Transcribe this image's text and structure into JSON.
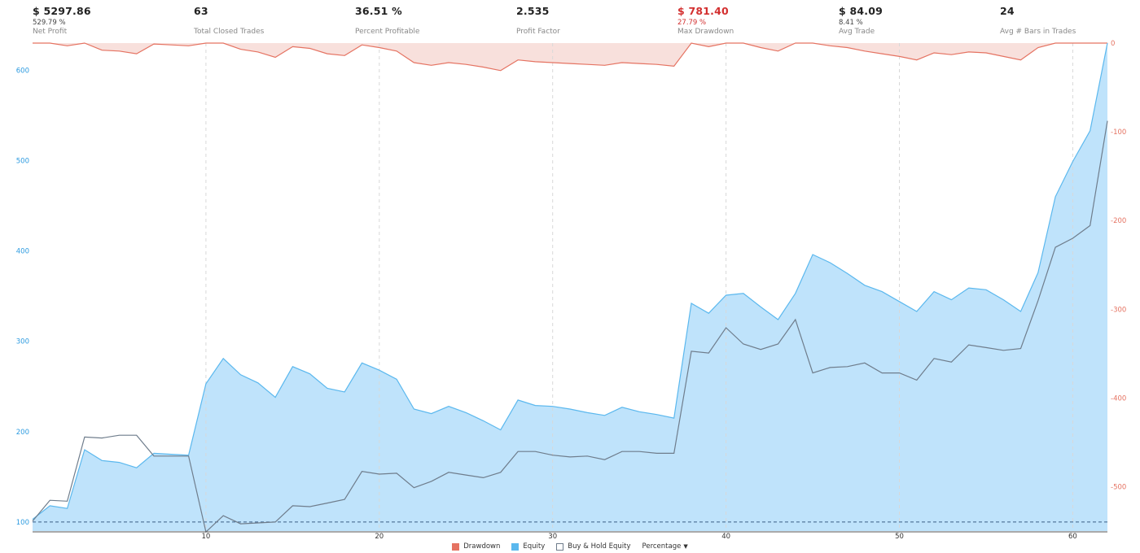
{
  "stats": [
    {
      "value": "$ 5297.86",
      "sub": "529.79 %",
      "label": "Net Profit",
      "red": false
    },
    {
      "value": "63",
      "sub": "",
      "label": "Total Closed Trades",
      "red": false
    },
    {
      "value": "36.51 %",
      "sub": "",
      "label": "Percent Profitable",
      "red": false
    },
    {
      "value": "2.535",
      "sub": "",
      "label": "Profit Factor",
      "red": false
    },
    {
      "value": "$ 781.40",
      "sub": "27.79 %",
      "label": "Max Drawdown",
      "red": true
    },
    {
      "value": "$ 84.09",
      "sub": "8.41 %",
      "label": "Avg Trade",
      "red": false
    },
    {
      "value": "24",
      "sub": "",
      "label": "Avg # Bars in Trades",
      "red": false
    }
  ],
  "legend": {
    "drawdown": "Drawdown",
    "equity": "Equity",
    "buyhold": "Buy & Hold Equity",
    "mode": "Percentage"
  },
  "colors": {
    "equity_fill": "#bfe3fb",
    "equity_line": "#5bb8ee",
    "drawdown_fill": "#f8e0dc",
    "drawdown_line": "#e57362",
    "buyhold_line": "#6f7d8c",
    "left_axis": "#2d9be0",
    "right_axis": "#e57362"
  },
  "chart_data": {
    "type": "area",
    "x": [
      0,
      1,
      2,
      3,
      4,
      5,
      6,
      7,
      8,
      9,
      10,
      11,
      12,
      13,
      14,
      15,
      16,
      17,
      18,
      19,
      20,
      21,
      22,
      23,
      24,
      25,
      26,
      27,
      28,
      29,
      30,
      31,
      32,
      33,
      34,
      35,
      36,
      37,
      38,
      39,
      40,
      41,
      42,
      43,
      44,
      45,
      46,
      47,
      48,
      49,
      50,
      51,
      52,
      53,
      54,
      55,
      56,
      57,
      58,
      59,
      60,
      61,
      62
    ],
    "xticks": [
      10,
      20,
      30,
      40,
      50,
      60
    ],
    "xlim": [
      0,
      62
    ],
    "equity_axis": {
      "ylim": [
        90,
        630
      ],
      "ticks": [
        100,
        200,
        300,
        400,
        500,
        600
      ]
    },
    "drawdown_axis": {
      "ylim": [
        -550,
        0
      ],
      "ticks": [
        0,
        -100,
        -200,
        -300,
        -400,
        -500
      ]
    },
    "baseline": 100,
    "series": [
      {
        "name": "Equity",
        "values": [
          103,
          118,
          115,
          180,
          168,
          166,
          160,
          176,
          175,
          174,
          253,
          281,
          263,
          254,
          238,
          272,
          264,
          248,
          244,
          276,
          268,
          258,
          225,
          220,
          228,
          221,
          212,
          202,
          235,
          229,
          228,
          225,
          221,
          218,
          227,
          222,
          219,
          215,
          342,
          331,
          351,
          353,
          338,
          324,
          353,
          396,
          387,
          375,
          362,
          355,
          344,
          333,
          355,
          346,
          359,
          357,
          346,
          333,
          376,
          460,
          499,
          533,
          630
        ]
      },
      {
        "name": "Buy & Hold Equity",
        "values": [
          101,
          124,
          123,
          194,
          193,
          196,
          196,
          173,
          173,
          173,
          89,
          107,
          98,
          99,
          100,
          118,
          117,
          121,
          125,
          156,
          153,
          154,
          138,
          145,
          155,
          152,
          149,
          155,
          178,
          178,
          174,
          172,
          173,
          169,
          178,
          178,
          176,
          176,
          289,
          287,
          315,
          297,
          291,
          297,
          324,
          265,
          271,
          272,
          276,
          265,
          265,
          257,
          281,
          277,
          296,
          293,
          290,
          292,
          345,
          404,
          414,
          428,
          544
        ]
      },
      {
        "name": "Drawdown",
        "values": [
          0,
          0,
          -3,
          0,
          -8,
          -9,
          -12,
          -1,
          -2,
          -3,
          0,
          0,
          -7,
          -10,
          -16,
          -4,
          -6,
          -12,
          -14,
          -2,
          -5,
          -9,
          -22,
          -25,
          -22,
          -24,
          -27,
          -31,
          -19,
          -21,
          -22,
          -23,
          -24,
          -25,
          -22,
          -23,
          -24,
          -26,
          0,
          -4,
          0,
          0,
          -5,
          -9,
          0,
          0,
          -3,
          -5,
          -9,
          -12,
          -15,
          -19,
          -11,
          -13,
          -10,
          -11,
          -15,
          -19,
          -5,
          0,
          0,
          0,
          0
        ]
      }
    ]
  }
}
